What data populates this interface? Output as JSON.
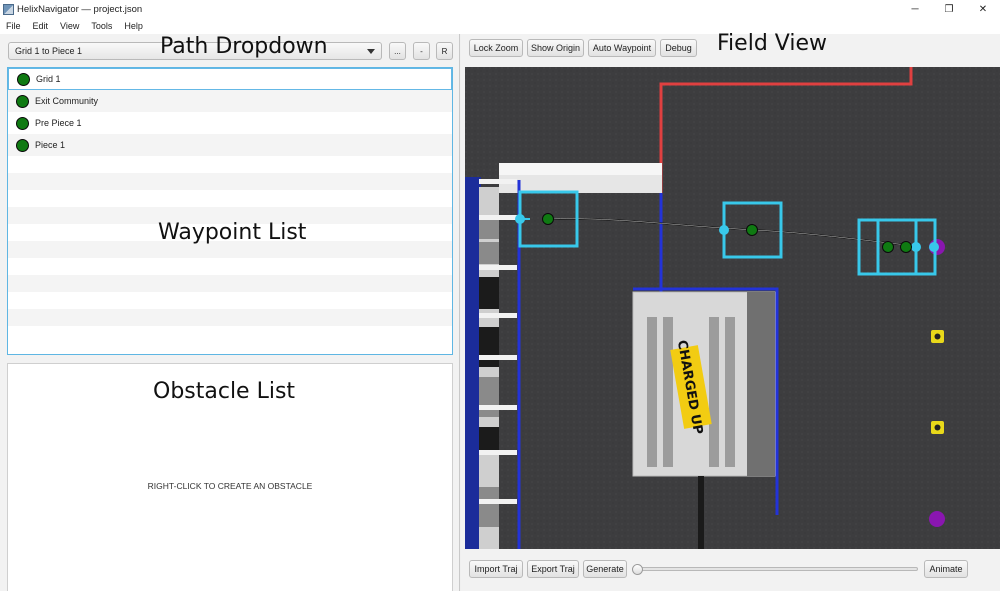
{
  "window": {
    "title": "HelixNavigator — project.json",
    "controls": {
      "minimize": "─",
      "maximize": "❐",
      "close": "✕"
    }
  },
  "menu": [
    "File",
    "Edit",
    "View",
    "Tools",
    "Help"
  ],
  "left": {
    "path_selected": "Grid 1 to Piece 1",
    "path_buttons": [
      "...",
      "-",
      "R"
    ],
    "waypoints": [
      "Grid 1",
      "Exit Community",
      "Pre Piece 1",
      "Piece 1"
    ],
    "obstacle_hint": "RIGHT-CLICK TO CREATE AN OBSTACLE"
  },
  "annotations": {
    "path_dropdown": "Path Dropdown",
    "waypoint_list": "Waypoint List",
    "obstacle_list": "Obstacle List",
    "field_view": "Field View"
  },
  "toolbar": {
    "lock_zoom": "Lock Zoom",
    "show_origin": "Show Origin",
    "auto_waypoint": "Auto Waypoint",
    "debug": "Debug"
  },
  "field": {
    "banner": "CHARGED UP",
    "colors": {
      "carpet": "#3d3d3f",
      "red_line": "#e04040",
      "blue_line": "#2333d8",
      "robot_box": "#38c8ea",
      "waypoint": "#0f7a12",
      "cube": "#8a16b0",
      "cone": "#e8d81a"
    }
  },
  "bottom": {
    "import": "Import Traj",
    "export": "Export Traj",
    "generate": "Generate",
    "animate": "Animate",
    "timeline_position": 0
  }
}
